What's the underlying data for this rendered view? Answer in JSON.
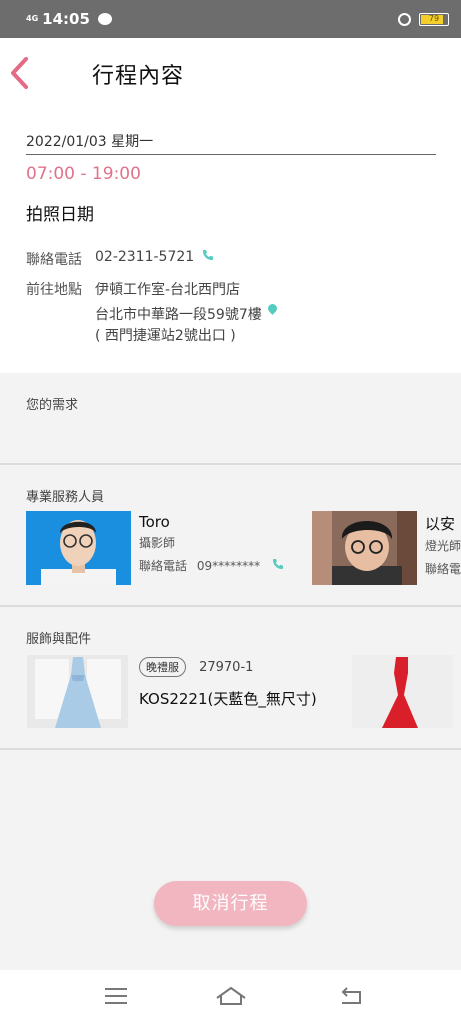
{
  "status": {
    "network": "4G",
    "time": "14:05",
    "battery": "79"
  },
  "header": {
    "title": "行程內容"
  },
  "schedule": {
    "date": "2022/01/03 星期一",
    "time_range": "07:00 - 19:00",
    "event": "拍照日期",
    "phone_label": "聯絡電話",
    "phone": "02-2311-5721",
    "address_label": "前往地點",
    "studio": "伊頓工作室-台北西門店",
    "address": "台北市中華路一段59號7樓",
    "address_note": "( 西門捷運站2號出口 )"
  },
  "needs": {
    "title": "您的需求"
  },
  "staff": {
    "title": "專業服務人員",
    "items": [
      {
        "name": "Toro",
        "role": "攝影師",
        "phone_label": "聯絡電話",
        "phone": "09********"
      },
      {
        "name": "以安",
        "role": "燈光師",
        "phone_label": "聯絡電話",
        "phone": ""
      }
    ]
  },
  "dresses": {
    "title": "服飾與配件",
    "items": [
      {
        "tag": "晚禮服",
        "code": "27970-1",
        "name": "KOS2221(天藍色_無尺寸)",
        "color": "#a9cbe6"
      },
      {
        "color": "#d81f2a"
      }
    ]
  },
  "actions": {
    "cancel": "取消行程"
  },
  "colors": {
    "accent": "#e0738c",
    "teal": "#55ccbf",
    "button": "#f1b6c0"
  }
}
